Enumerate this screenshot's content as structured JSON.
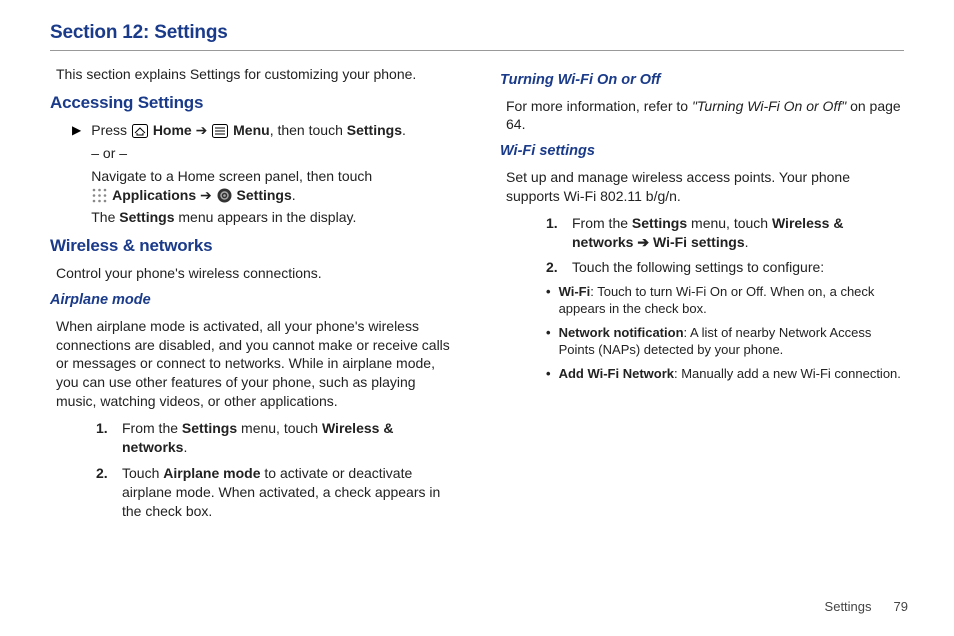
{
  "section_title": "Section 12: Settings",
  "intro": "This section explains Settings for customizing your phone.",
  "h_accessing": "Accessing Settings",
  "step": {
    "press": "Press ",
    "home": "Home",
    "arrow": " ➔ ",
    "menu": "Menu",
    "then_settings": ", then touch ",
    "settings_bold": "Settings",
    "period": ".",
    "or": "– or –",
    "nav": "Navigate to a Home screen panel, then touch ",
    "apps": "Applications",
    "arrow2": " ➔ ",
    "settings2": "Settings",
    "period2": ".",
    "menu_appears_1": "The ",
    "menu_appears_b": "Settings",
    "menu_appears_2": " menu appears in the display."
  },
  "h_wireless": "Wireless & networks",
  "wireless_intro": "Control your phone's wireless connections.",
  "h_airplane": "Airplane mode",
  "airplane_para": "When airplane mode is activated, all your phone's wireless connections are disabled, and you cannot make or receive calls or messages or connect to networks. While in airplane mode, you can use other features of your phone, such as playing music, watching videos, or other applications.",
  "airplane_steps": [
    {
      "n": "1.",
      "pre": "From the ",
      "b1": "Settings",
      "mid": " menu, touch ",
      "b2": "Wireless & networks",
      "post": "."
    },
    {
      "n": "2.",
      "pre": "Touch ",
      "b1": "Airplane mode",
      "mid": " to activate or deactivate airplane mode. When activated, a check appears in the check box.",
      "b2": "",
      "post": ""
    }
  ],
  "h_turning": "Turning Wi-Fi On or Off",
  "turning_pre": "For more information, refer to ",
  "turning_quote": "\"Turning Wi-Fi On or Off\"",
  "turning_post": " on page 64.",
  "h_wifi_settings": "Wi-Fi settings",
  "wifi_para": "Set up and manage wireless access points. Your phone supports Wi-Fi 802.11 b/g/n.",
  "wifi_steps": [
    {
      "n": "1.",
      "pre": "From the ",
      "b1": "Settings",
      "mid": " menu, touch ",
      "b2": "Wireless & networks ➔ Wi-Fi settings",
      "post": "."
    },
    {
      "n": "2.",
      "pre": "Touch the following settings to configure:",
      "b1": "",
      "mid": "",
      "b2": "",
      "post": ""
    }
  ],
  "wifi_bullets": [
    {
      "b": "Wi-Fi",
      "t": ": Touch to turn Wi-Fi On or Off. When on, a check appears in the check box."
    },
    {
      "b": "Network notification",
      "t": ": A list of nearby Network Access Points (NAPs) detected by your phone."
    },
    {
      "b": "Add Wi-Fi Network",
      "t": ": Manually add a new Wi-Fi connection."
    }
  ],
  "footer": {
    "label": "Settings",
    "page": "79"
  }
}
